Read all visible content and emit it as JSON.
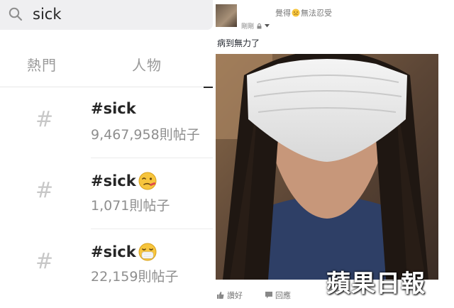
{
  "search": {
    "query": "sick"
  },
  "tabs": [
    {
      "label": "熱門"
    },
    {
      "label": "人物"
    }
  ],
  "results": [
    {
      "hashtag": "#sick",
      "count": "9,467,958則帖子",
      "emoji": ""
    },
    {
      "hashtag": "#sick",
      "count": "1,071則帖子",
      "emoji": "sick-face-emoji"
    },
    {
      "hashtag": "#sick",
      "count": "22,159則帖子",
      "emoji": "medical-mask-emoji"
    }
  ],
  "hash_symbol": "#",
  "post": {
    "feeling_prefix": "覺得",
    "feeling_text": "無法忍受",
    "time": "剛剛",
    "status": "病到無力了",
    "like_label": "讚好",
    "comment_label": "回應"
  },
  "watermark": "蘋果日報",
  "colors": {
    "search_bg": "#efeff1",
    "hash_grey": "#c7c7c7",
    "count_grey": "#8e8e8e"
  }
}
